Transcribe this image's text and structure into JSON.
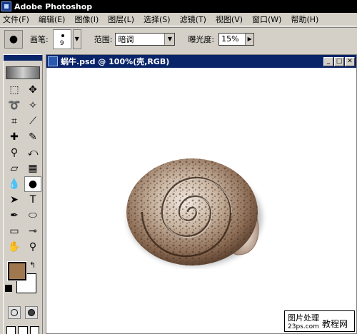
{
  "app": {
    "title": "Adobe Photoshop"
  },
  "menu": [
    "文件(F)",
    "编辑(E)",
    "图像(I)",
    "图层(L)",
    "选择(S)",
    "滤镜(T)",
    "视图(V)",
    "窗口(W)",
    "帮助(H)"
  ],
  "options": {
    "brush_label": "画笔:",
    "brush_size": "9",
    "range_label": "范围:",
    "range_value": "暗调",
    "exposure_label": "曝光度:",
    "exposure_value": "15%"
  },
  "document": {
    "title": "蜗牛.psd @ 100%(壳,RGB)"
  },
  "colors": {
    "foreground": "#a07850",
    "background": "#ffffff"
  },
  "tools": [
    {
      "name": "marquee-tool-icon",
      "glyph": "⬚"
    },
    {
      "name": "move-tool-icon",
      "glyph": "✥"
    },
    {
      "name": "lasso-tool-icon",
      "glyph": "➰"
    },
    {
      "name": "magic-wand-tool-icon",
      "glyph": "✧"
    },
    {
      "name": "crop-tool-icon",
      "glyph": "⌗"
    },
    {
      "name": "slice-tool-icon",
      "glyph": "⟋"
    },
    {
      "name": "healing-brush-tool-icon",
      "glyph": "✚"
    },
    {
      "name": "brush-tool-icon",
      "glyph": "✎"
    },
    {
      "name": "stamp-tool-icon",
      "glyph": "⚲"
    },
    {
      "name": "history-brush-tool-icon",
      "glyph": "⤺"
    },
    {
      "name": "eraser-tool-icon",
      "glyph": "▱"
    },
    {
      "name": "gradient-tool-icon",
      "glyph": "▦"
    },
    {
      "name": "blur-tool-icon",
      "glyph": "💧"
    },
    {
      "name": "burn-tool-icon",
      "glyph": "●"
    },
    {
      "name": "path-selection-tool-icon",
      "glyph": "➤"
    },
    {
      "name": "type-tool-icon",
      "glyph": "T"
    },
    {
      "name": "pen-tool-icon",
      "glyph": "✒"
    },
    {
      "name": "shape-tool-icon",
      "glyph": "⬭"
    },
    {
      "name": "notes-tool-icon",
      "glyph": "▭"
    },
    {
      "name": "eyedropper-tool-icon",
      "glyph": "⊸"
    },
    {
      "name": "hand-tool-icon",
      "glyph": "✋"
    },
    {
      "name": "zoom-tool-icon",
      "glyph": "⚲"
    }
  ],
  "watermark": {
    "line1": "图片处理",
    "line2": "23ps.com",
    "line3": "教程网"
  }
}
